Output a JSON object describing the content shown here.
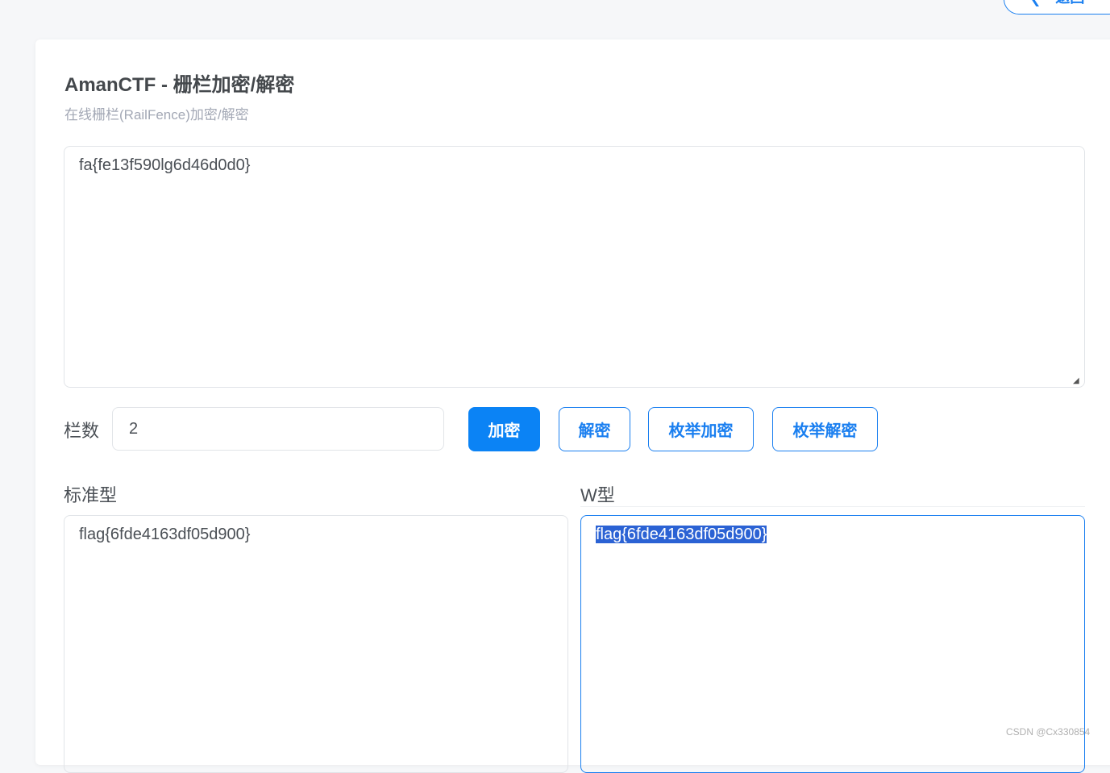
{
  "header": {
    "back_button_label": "返回"
  },
  "card": {
    "title": "AmanCTF - 栅栏加密/解密",
    "subtitle": "在线栅栏(RailFence)加密/解密"
  },
  "input": {
    "value": "fa{fe13f590lg6d46d0d0}"
  },
  "controls": {
    "rails_label": "栏数",
    "rails_value": "2",
    "encrypt_label": "加密",
    "decrypt_label": "解密",
    "enum_encrypt_label": "枚举加密",
    "enum_decrypt_label": "枚举解密"
  },
  "results": {
    "standard_label": "标准型",
    "standard_value": "flag{6fde4163df05d900}",
    "w_label": "W型",
    "w_value": "flag{6fde4163df05d900}"
  },
  "watermark": "CSDN @Cx330854",
  "colors": {
    "accent": "#1a7ff0",
    "primary_button": "#0b83f5",
    "selection": "#2b62d4"
  }
}
